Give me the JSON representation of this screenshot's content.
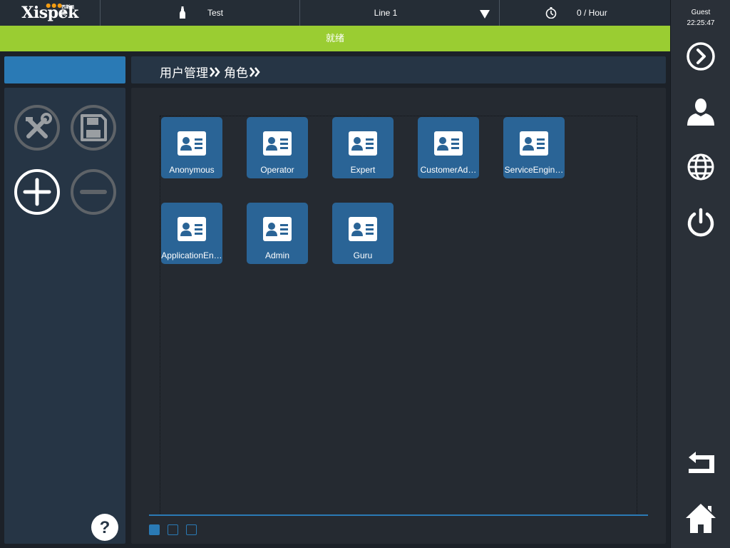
{
  "header": {
    "logo_text": "Xispek",
    "logo_subtext": "西斯派克",
    "product_label": "Test",
    "line_label": "Line 1",
    "rate_label": "0 / Hour"
  },
  "status": {
    "text": "就绪",
    "color": "#9acd32"
  },
  "user": {
    "name": "Guest",
    "time": "22:25:47"
  },
  "breadcrumb": {
    "items": [
      "用户管理",
      "角色"
    ]
  },
  "roles": [
    {
      "label": "Anonymous",
      "icon": "id-card-icon"
    },
    {
      "label": "Operator",
      "icon": "id-card-icon"
    },
    {
      "label": "Expert",
      "icon": "id-card-icon"
    },
    {
      "label": "CustomerAd…",
      "icon": "id-card-icon"
    },
    {
      "label": "ServiceEngin…",
      "icon": "id-card-icon"
    },
    {
      "label": "ApplicationEn…",
      "icon": "id-card-icon"
    },
    {
      "label": "Admin",
      "icon": "id-card-icon"
    },
    {
      "label": "Guru",
      "icon": "id-card-icon"
    }
  ],
  "pager": {
    "pages": 3,
    "current": 1
  },
  "tools": [
    "tools-icon",
    "save-icon",
    "add-icon",
    "remove-icon",
    "help-icon"
  ],
  "rail": [
    "next-icon",
    "user-icon",
    "globe-icon",
    "power-icon",
    "back-icon",
    "home-icon"
  ],
  "colors": {
    "accent": "#2a7ab5",
    "tile": "#2a6496",
    "status": "#9acd32",
    "panel": "#263545"
  }
}
